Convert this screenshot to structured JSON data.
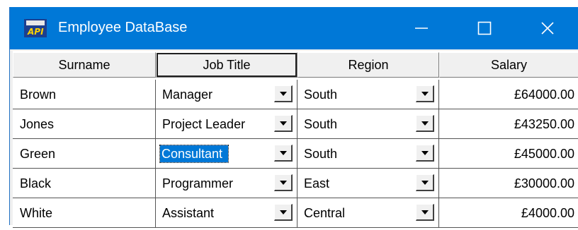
{
  "window": {
    "title": "Employee DataBase",
    "icon": "app-icon",
    "controls": [
      "minimize-icon",
      "maximize-icon",
      "close-icon"
    ],
    "accent": "#0078d7"
  },
  "grid": {
    "headers": [
      "Surname",
      "Job Title",
      "Region",
      "Salary"
    ],
    "selected_header": 1,
    "rows": [
      {
        "surname": "Brown",
        "job": "Manager",
        "region": "South",
        "salary": "£64000.00"
      },
      {
        "surname": "Jones",
        "job": "Project Leader",
        "region": "South",
        "salary": "£43250.00"
      },
      {
        "surname": "Green",
        "job": "Consultant",
        "region": "South",
        "salary": "£45000.00"
      },
      {
        "surname": "Black",
        "job": "Programmer",
        "region": "East",
        "salary": "£30000.00"
      },
      {
        "surname": "White",
        "job": "Assistant",
        "region": "Central",
        "salary": "£4000.00"
      }
    ],
    "selected_cell": {
      "row": 2,
      "column": "job"
    }
  }
}
